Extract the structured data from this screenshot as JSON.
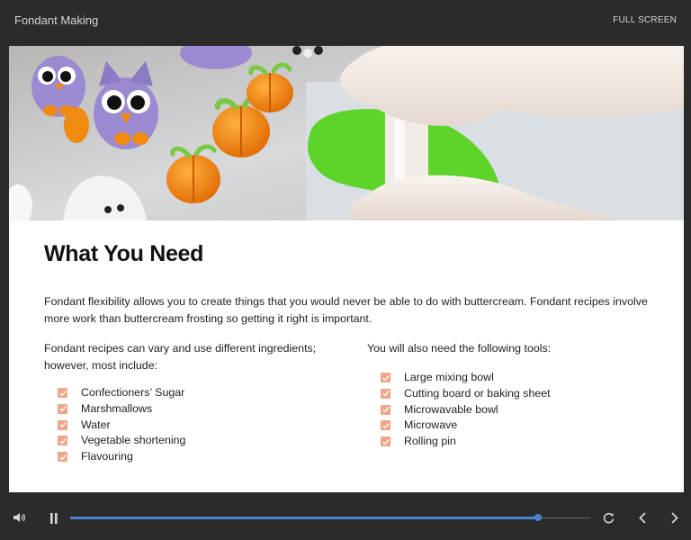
{
  "header": {
    "course_title": "Fondant Making",
    "fullscreen_label": "FULL SCREEN"
  },
  "slide": {
    "heading": "What You Need",
    "intro": "Fondant flexibility allows you to create things that you would never be able to do with buttercream. Fondant recipes involve more work than buttercream frosting so getting it right is important.",
    "ingredients": {
      "lead": "Fondant recipes can vary and use different ingredients; however, most include:",
      "items": [
        "Confectioners’ Sugar",
        "Marshmallows",
        "Water",
        "Vegetable shortening",
        "Flavouring"
      ]
    },
    "tools": {
      "lead": "You will also need the following tools:",
      "items": [
        "Large mixing bowl",
        "Cutting board or baking sheet",
        "Microwavable bowl",
        "Microwave",
        "Rolling pin"
      ]
    },
    "checkbox_color": "#f0a58a"
  },
  "player": {
    "progress": 0.9,
    "accent_color": "#4a84d1",
    "icons": [
      "volume-icon",
      "pause-icon",
      "replay-icon",
      "chevron-left-icon",
      "chevron-right-icon"
    ]
  }
}
